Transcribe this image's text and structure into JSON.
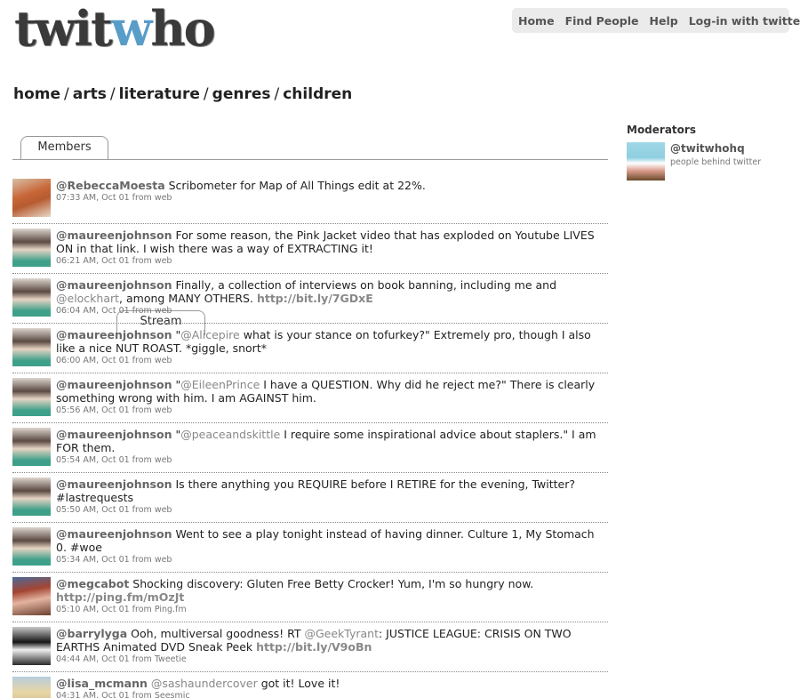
{
  "logo": {
    "part1": "twit",
    "part2": "w",
    "part3": "ho"
  },
  "nav": [
    "Home",
    "Find People",
    "Help",
    "Log-in with twitter"
  ],
  "breadcrumb": [
    "home",
    "arts",
    "literature",
    "genres",
    "children"
  ],
  "tabs": {
    "members": "Members",
    "stream": "Stream"
  },
  "stream": [
    {
      "avatar": "rebecca",
      "segments": [
        {
          "t": "user",
          "v": "@RebeccaMoesta"
        },
        {
          "t": "text",
          "v": " Scribometer for Map of All Things edit at 22%."
        }
      ],
      "meta": "07:33 AM, Oct 01 from web"
    },
    {
      "avatar": "maureen",
      "segments": [
        {
          "t": "user",
          "v": "@maureenjohnson"
        },
        {
          "t": "text",
          "v": " For some reason, the Pink Jacket video that has exploded on Youtube LIVES ON in that link. I wish there was a way of EXTRACTING it!"
        }
      ],
      "meta": "06:21 AM, Oct 01 from web"
    },
    {
      "avatar": "maureen",
      "segments": [
        {
          "t": "user",
          "v": "@maureenjohnson"
        },
        {
          "t": "text",
          "v": " Finally, a collection of interviews on book banning, including me and "
        },
        {
          "t": "mention",
          "v": "@elockhart"
        },
        {
          "t": "text",
          "v": ", among MANY OTHERS. "
        },
        {
          "t": "link",
          "v": "http://bit.ly/7GDxE"
        }
      ],
      "meta": "06:04 AM, Oct 01 from web"
    },
    {
      "avatar": "maureen",
      "segments": [
        {
          "t": "user",
          "v": "@maureenjohnson"
        },
        {
          "t": "text",
          "v": " \""
        },
        {
          "t": "mention",
          "v": "@Alicepire"
        },
        {
          "t": "text",
          "v": " what is your stance on tofurkey?\" Extremely pro, though I also like a nice NUT ROAST. *giggle, snort*"
        }
      ],
      "meta": "06:00 AM, Oct 01 from web"
    },
    {
      "avatar": "maureen",
      "segments": [
        {
          "t": "user",
          "v": "@maureenjohnson"
        },
        {
          "t": "text",
          "v": " \""
        },
        {
          "t": "mention",
          "v": "@EileenPrince"
        },
        {
          "t": "text",
          "v": " I have a QUESTION. Why did he reject me?\" There is clearly something wrong with him. I am AGAINST him."
        }
      ],
      "meta": "05:56 AM, Oct 01 from web"
    },
    {
      "avatar": "maureen",
      "segments": [
        {
          "t": "user",
          "v": "@maureenjohnson"
        },
        {
          "t": "text",
          "v": " \""
        },
        {
          "t": "mention",
          "v": "@peaceandskittle"
        },
        {
          "t": "text",
          "v": " I require some inspirational advice about staplers.\" I am FOR them."
        }
      ],
      "meta": "05:54 AM, Oct 01 from web"
    },
    {
      "avatar": "maureen",
      "segments": [
        {
          "t": "user",
          "v": "@maureenjohnson"
        },
        {
          "t": "text",
          "v": " Is there anything you REQUIRE before I RETIRE for the evening, Twitter? #lastrequests"
        }
      ],
      "meta": "05:50 AM, Oct 01 from web"
    },
    {
      "avatar": "maureen",
      "segments": [
        {
          "t": "user",
          "v": "@maureenjohnson"
        },
        {
          "t": "text",
          "v": " Went to see a play tonight instead of having dinner. Culture 1, My Stomach 0. #woe"
        }
      ],
      "meta": "05:34 AM, Oct 01 from web"
    },
    {
      "avatar": "megcabot",
      "segments": [
        {
          "t": "user",
          "v": "@megcabot"
        },
        {
          "t": "text",
          "v": " Shocking discovery: Gluten Free Betty Crocker! Yum, I'm so hungry now. "
        },
        {
          "t": "link",
          "v": "http://ping.fm/mOzJt"
        }
      ],
      "meta": "05:10 AM, Oct 01 from Ping.fm"
    },
    {
      "avatar": "barrylyga",
      "segments": [
        {
          "t": "user",
          "v": "@barrylyga"
        },
        {
          "t": "text",
          "v": " Ooh, multiversal goodness! RT "
        },
        {
          "t": "mention",
          "v": "@GeekTyrant"
        },
        {
          "t": "text",
          "v": ": JUSTICE LEAGUE: CRISIS ON TWO EARTHS Animated DVD Sneak Peek "
        },
        {
          "t": "link",
          "v": "http://bit.ly/V9oBn"
        }
      ],
      "meta": "04:44 AM, Oct 01 from Tweetie"
    },
    {
      "avatar": "lisa",
      "segments": [
        {
          "t": "user",
          "v": "@lisa_mcmann"
        },
        {
          "t": "text",
          "v": " "
        },
        {
          "t": "mention",
          "v": "@sashaundercover"
        },
        {
          "t": "text",
          "v": " got it! Love it!"
        }
      ],
      "meta": "04:31 AM, Oct 01 from Seesmic"
    }
  ],
  "sidebar": {
    "title": "Moderators",
    "moderator": {
      "name": "@twitwhohq",
      "desc": "people behind twitter"
    }
  }
}
